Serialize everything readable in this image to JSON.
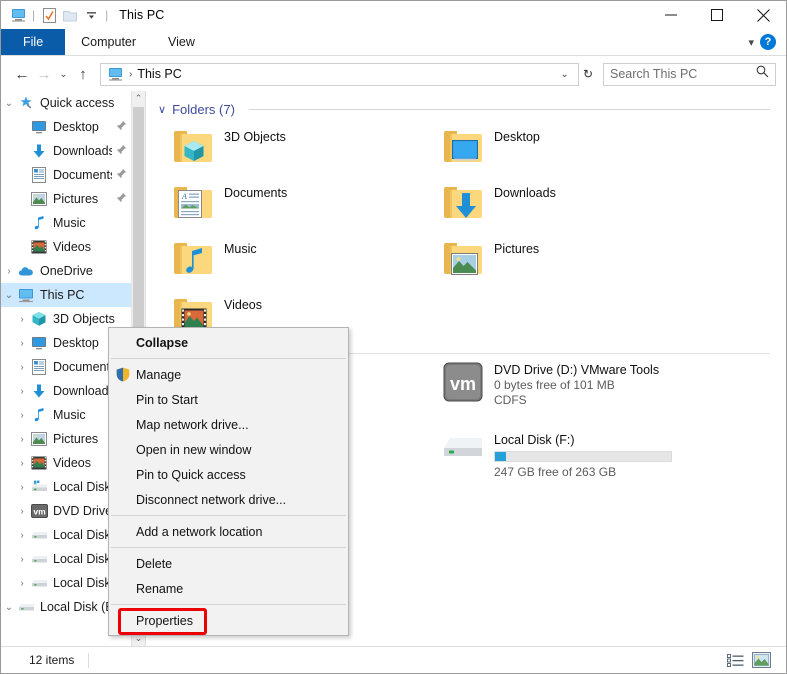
{
  "window": {
    "title": "This PC",
    "quick_access_icons": [
      "this-pc-icon",
      "properties-icon",
      "new-folder-icon",
      "customize-dropdown-icon"
    ],
    "controls": {
      "minimize": "—",
      "maximize": "☐",
      "close": "✕"
    }
  },
  "ribbon": {
    "tabs": [
      {
        "label": "File",
        "active": true
      },
      {
        "label": "Computer",
        "active": false
      },
      {
        "label": "View",
        "active": false
      }
    ],
    "collapse_icon": "chevron-down-icon",
    "help_label": "?"
  },
  "addressbar": {
    "back_icon": "←",
    "forward_icon": "→",
    "recent_icon": "⌄",
    "up_icon": "↑",
    "breadcrumb": {
      "root_icon": "this-pc-icon",
      "separator": "›",
      "path": "This PC"
    },
    "dropdown_icon": "⌄",
    "refresh_icon": "↻",
    "search": {
      "placeholder": "Search This PC",
      "value": "",
      "icon": "search-icon"
    }
  },
  "sidebar": {
    "items": [
      {
        "label": "Quick access",
        "twisty": "∨",
        "icon": "star-pin-icon",
        "indent": 0,
        "pinned": false,
        "selected": false
      },
      {
        "label": "Desktop",
        "twisty": "",
        "icon": "desktop-icon",
        "indent": 1,
        "pinned": true,
        "selected": false
      },
      {
        "label": "Downloads",
        "twisty": "",
        "icon": "downloads-icon",
        "indent": 1,
        "pinned": true,
        "selected": false
      },
      {
        "label": "Documents",
        "twisty": "",
        "icon": "documents-icon",
        "indent": 1,
        "pinned": true,
        "selected": false
      },
      {
        "label": "Pictures",
        "twisty": "",
        "icon": "pictures-icon",
        "indent": 1,
        "pinned": true,
        "selected": false
      },
      {
        "label": "Music",
        "twisty": "",
        "icon": "music-icon",
        "indent": 1,
        "pinned": false,
        "selected": false
      },
      {
        "label": "Videos",
        "twisty": "",
        "icon": "videos-icon",
        "indent": 1,
        "pinned": false,
        "selected": false
      },
      {
        "label": "OneDrive",
        "twisty": "›",
        "icon": "onedrive-icon",
        "indent": 0,
        "pinned": false,
        "selected": false
      },
      {
        "label": "This PC",
        "twisty": "∨",
        "icon": "this-pc-icon",
        "indent": 0,
        "pinned": false,
        "selected": true
      },
      {
        "label": "3D Objects",
        "twisty": "›",
        "icon": "3d-objects-icon",
        "indent": 1,
        "pinned": false,
        "selected": false
      },
      {
        "label": "Desktop",
        "twisty": "›",
        "icon": "desktop-icon",
        "indent": 1,
        "pinned": false,
        "selected": false
      },
      {
        "label": "Documents",
        "twisty": "›",
        "icon": "documents-icon",
        "indent": 1,
        "pinned": false,
        "selected": false
      },
      {
        "label": "Downloads",
        "twisty": "›",
        "icon": "downloads-icon",
        "indent": 1,
        "pinned": false,
        "selected": false
      },
      {
        "label": "Music",
        "twisty": "›",
        "icon": "music-icon",
        "indent": 1,
        "pinned": false,
        "selected": false
      },
      {
        "label": "Pictures",
        "twisty": "›",
        "icon": "pictures-icon",
        "indent": 1,
        "pinned": false,
        "selected": false
      },
      {
        "label": "Videos",
        "twisty": "›",
        "icon": "videos-icon",
        "indent": 1,
        "pinned": false,
        "selected": false
      },
      {
        "label": "Local Disk (C:)",
        "twisty": "›",
        "icon": "system-drive-icon",
        "indent": 1,
        "pinned": false,
        "selected": false
      },
      {
        "label": "DVD Drive (D:)",
        "twisty": "›",
        "icon": "vmware-dvd-icon",
        "indent": 1,
        "pinned": false,
        "selected": false
      },
      {
        "label": "Local Disk (E:)",
        "twisty": "›",
        "icon": "drive-icon",
        "indent": 1,
        "pinned": false,
        "selected": false
      },
      {
        "label": "Local Disk (F:)",
        "twisty": "›",
        "icon": "drive-icon",
        "indent": 1,
        "pinned": false,
        "selected": false
      },
      {
        "label": "Local Disk (G:)",
        "twisty": "›",
        "icon": "drive-icon",
        "indent": 1,
        "pinned": false,
        "selected": false
      },
      {
        "label": "Local Disk (E:)",
        "twisty": "∨",
        "icon": "drive-icon",
        "indent": 0,
        "pinned": false,
        "selected": false
      }
    ],
    "scroll_up_icon": "⌃",
    "scroll_down_icon": "⌄"
  },
  "main": {
    "folders_group": {
      "caret": "∨",
      "title": "Folders (7)",
      "items": [
        {
          "name": "3D Objects",
          "icon": "folder-3d-objects-icon"
        },
        {
          "name": "Desktop",
          "icon": "folder-desktop-icon"
        },
        {
          "name": "Documents",
          "icon": "folder-documents-icon"
        },
        {
          "name": "Downloads",
          "icon": "folder-downloads-icon"
        },
        {
          "name": "Music",
          "icon": "folder-music-icon"
        },
        {
          "name": "Pictures",
          "icon": "folder-pictures-icon"
        },
        {
          "name": "Videos",
          "icon": "folder-videos-icon"
        }
      ]
    },
    "devices_group": {
      "drives": [
        {
          "name": "DVD Drive (D:) VMware Tools",
          "meta": "0 bytes free of 101 MB",
          "filesystem": "CDFS",
          "icon": "vmware-dvd-icon",
          "has_bar": false,
          "used_percent": 0
        },
        {
          "name": "Local Disk (F:)",
          "meta": "247 GB free of 263 GB",
          "filesystem": "",
          "icon": "drive-icon",
          "has_bar": true,
          "used_percent": 6
        }
      ]
    }
  },
  "contextmenu": {
    "items": [
      {
        "label": "Collapse",
        "bold": true,
        "icon": "",
        "divider_after": true
      },
      {
        "label": "Manage",
        "bold": false,
        "icon": "shield-icon",
        "divider_after": false
      },
      {
        "label": "Pin to Start",
        "bold": false,
        "icon": "",
        "divider_after": false
      },
      {
        "label": "Map network drive...",
        "bold": false,
        "icon": "",
        "divider_after": false
      },
      {
        "label": "Open in new window",
        "bold": false,
        "icon": "",
        "divider_after": false
      },
      {
        "label": "Pin to Quick access",
        "bold": false,
        "icon": "",
        "divider_after": false
      },
      {
        "label": "Disconnect network drive...",
        "bold": false,
        "icon": "",
        "divider_after": true
      },
      {
        "label": "Add a network location",
        "bold": false,
        "icon": "",
        "divider_after": true
      },
      {
        "label": "Delete",
        "bold": false,
        "icon": "",
        "divider_after": false
      },
      {
        "label": "Rename",
        "bold": false,
        "icon": "",
        "divider_after": true
      },
      {
        "label": "Properties",
        "bold": false,
        "icon": "",
        "divider_after": false
      }
    ],
    "highlight_target": "Properties",
    "highlight_color": "#ee0000"
  },
  "statusbar": {
    "item_count": "12 items",
    "view_buttons": [
      {
        "name": "details-view-button",
        "active": false
      },
      {
        "name": "large-icons-view-button",
        "active": true
      }
    ]
  },
  "colors": {
    "accent": "#0b5ca8",
    "selection": "#cce8ff",
    "group_header": "#3e4a9c",
    "progress": "#26a0da",
    "highlight": "#ee0000"
  }
}
